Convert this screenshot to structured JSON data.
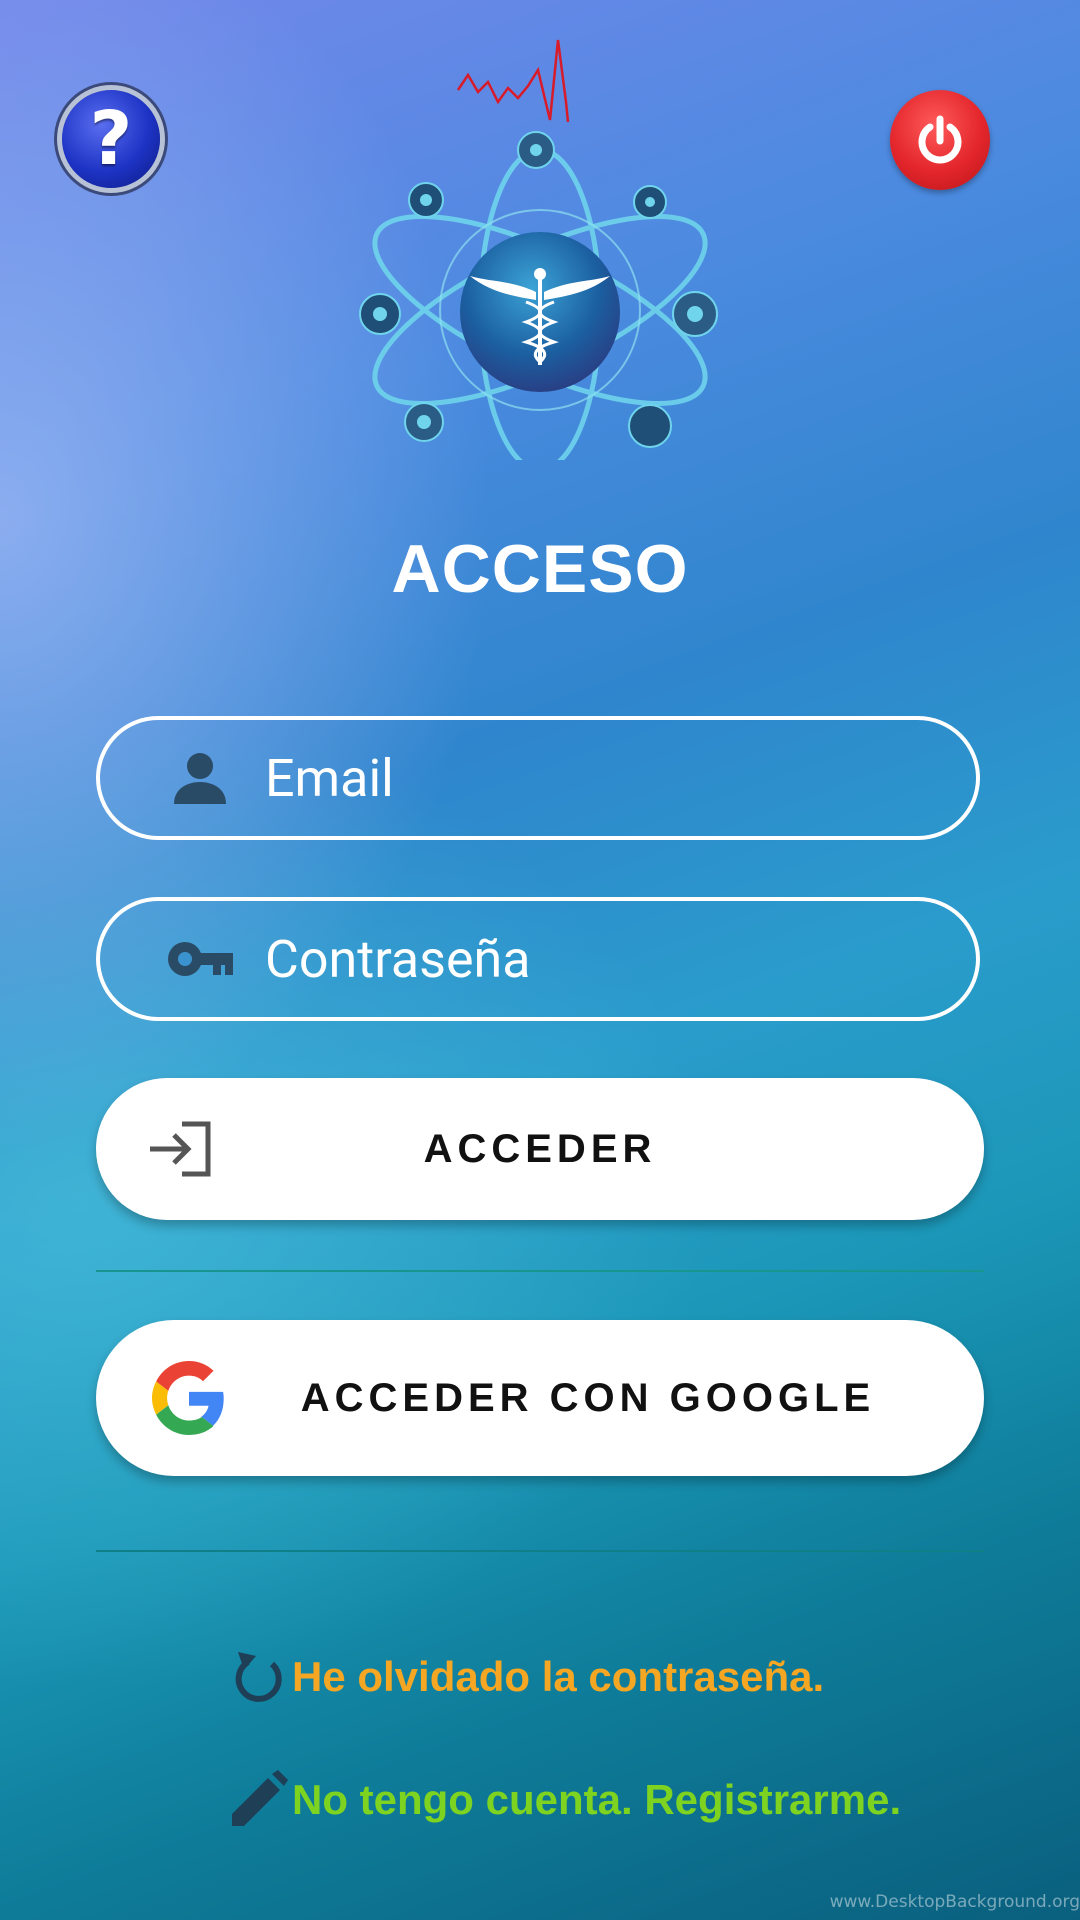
{
  "header": {
    "help_symbol": "?",
    "help_icon": "help-icon",
    "power_icon": "power-icon"
  },
  "logo": {
    "description_icon": "caduceus-atom-gears-logo"
  },
  "title": "ACCESO",
  "form": {
    "email_placeholder": "Email",
    "email_value": "",
    "password_placeholder": "Contraseña",
    "password_value": "",
    "login_label": "ACCEDER",
    "google_label": "ACCEDER CON GOOGLE"
  },
  "links": {
    "forgot": "He olvidado la contraseña.",
    "register": "No tengo cuenta. Registrarme."
  },
  "watermark": "www.DesktopBackground.org",
  "colors": {
    "forgot": "#f5a623",
    "register": "#7ed321",
    "power": "#e3262b",
    "help": "#1d33c4"
  }
}
